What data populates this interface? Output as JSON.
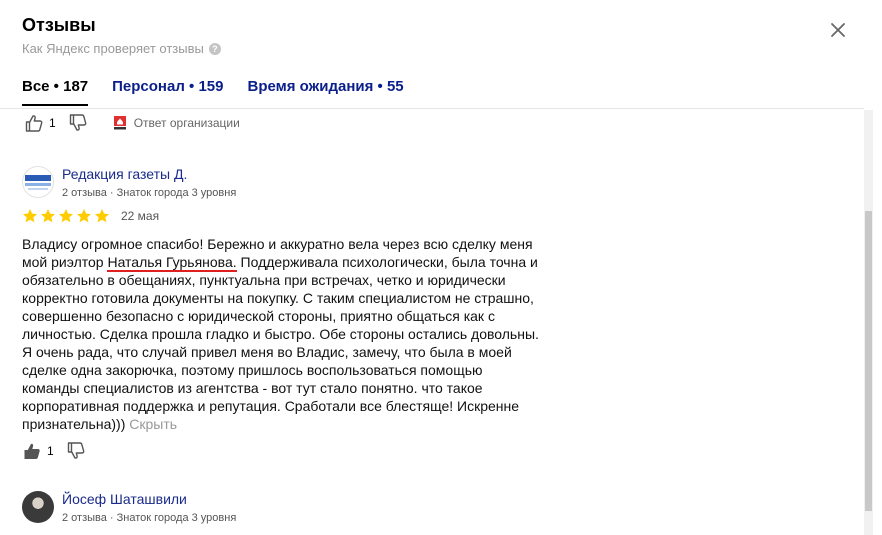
{
  "header": {
    "title": "Отзывы",
    "subtitle": "Как Яндекс проверяет отзывы",
    "help_glyph": "?"
  },
  "tabs": [
    {
      "label": "Все • 187",
      "active": true
    },
    {
      "label": "Персонал • 159",
      "active": false
    },
    {
      "label": "Время ожидания • 55",
      "active": false
    }
  ],
  "prev_review": {
    "likes": "1",
    "org_answer_label": "Ответ организации"
  },
  "review1": {
    "author": "Редакция газеты Д.",
    "meta": "2 отзыва · Знаток города 3 уровня",
    "rating": 5,
    "date": "22 мая",
    "text_before": "Владису огромное спасибо! Бережно и аккуратно вела через всю сделку меня мой риэлтор ",
    "text_highlight": "Наталья Гурьянова.",
    "text_after": " Поддерживала психологически, была точна и обязательно в обещаниях, пунктуальна при встречах, четко и юридически корректно готовила документы на покупку. С таким специалистом не страшно, совершенно безопасно с юридической стороны, приятно общаться как с личностью. Сделка прошла гладко и быстро. Обе стороны остались довольны. Я очень рада, что случай привел меня во Владис, замечу, что была в моей сделке одна закорючка, поэтому пришлось воспользоваться помощью команды специалистов из агентства - вот тут стало понятно. что такое корпоративная поддержка и репутация. Сработали все блестяще! Искренне признательна))) ",
    "collapse_label": "Скрыть",
    "likes": "1"
  },
  "review2": {
    "author": "Йосеф Шаташвили",
    "meta": "2 отзыва · Знаток города 3 уровня"
  },
  "colors": {
    "star": "#fc0",
    "link": "#1a2b8a",
    "highlight_underline": "#e02020"
  }
}
